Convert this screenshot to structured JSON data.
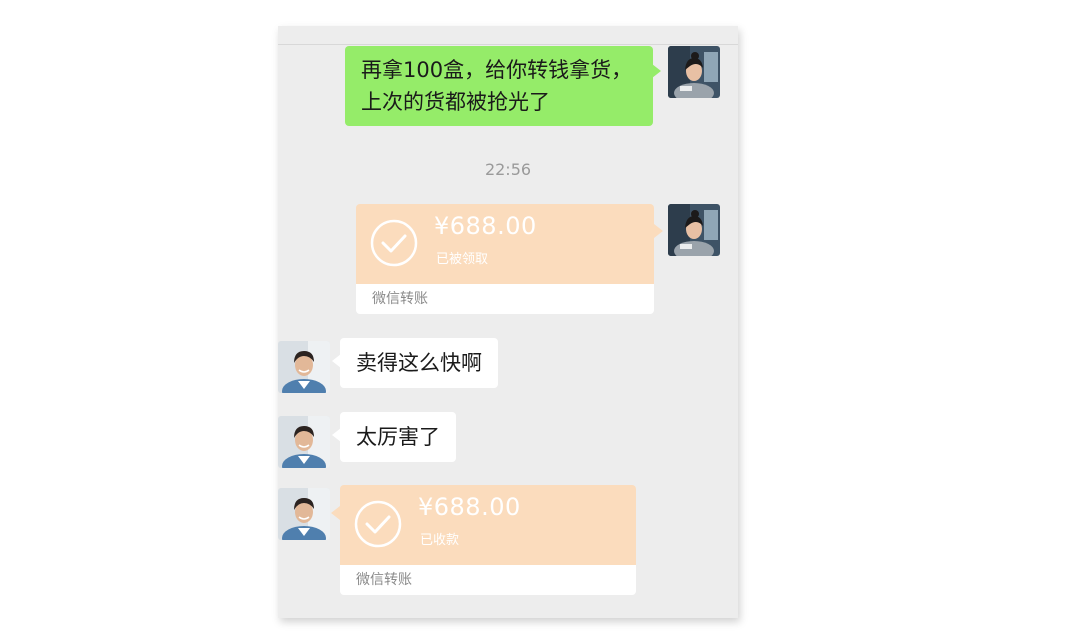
{
  "chat": {
    "messages": {
      "m1": "再拿100盒，给你转钱拿货，\n上次的货都被抢光了",
      "m1_line1": "再拿100盒，给你转钱拿货，",
      "m1_line2": "上次的货都被抢光了",
      "timestamp": "22:56",
      "transfer_sent": {
        "amount": "¥688.00",
        "status": "已被领取",
        "footer": "微信转账"
      },
      "m2": "卖得这么快啊",
      "m3": "太厉害了",
      "transfer_received": {
        "amount": "¥688.00",
        "status": "已收款",
        "footer": "微信转账"
      }
    }
  },
  "colors": {
    "background": "#ededed",
    "green_bubble": "#95ec69",
    "transfer_card": "#fbdcbd",
    "white_bubble": "#ffffff"
  },
  "icons": {
    "transfer": "check-circle-icon",
    "avatar_female": "avatar-woman",
    "avatar_male": "avatar-man"
  }
}
